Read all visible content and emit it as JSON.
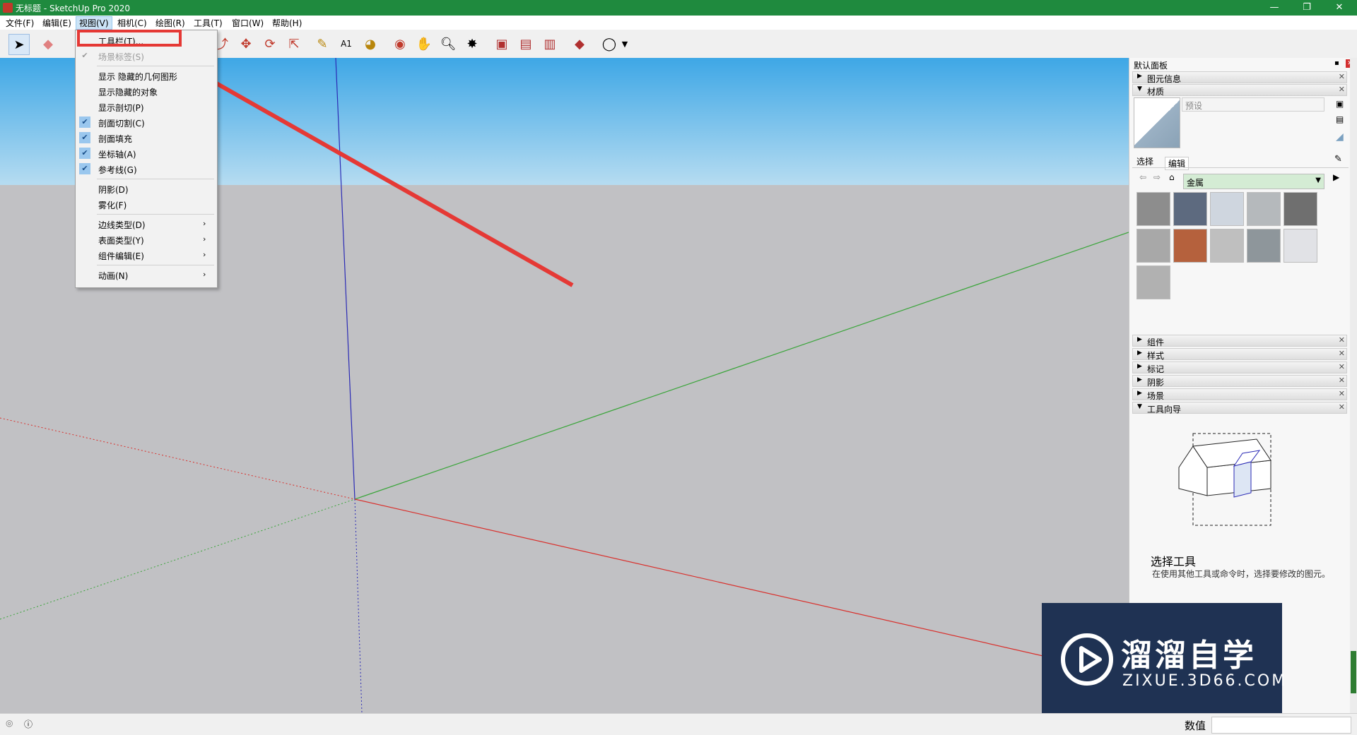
{
  "window": {
    "title": "无标题 - SketchUp Pro 2020",
    "minimize": "—",
    "restore": "❐",
    "close": "✕"
  },
  "menubar": {
    "items": [
      "文件(F)",
      "编辑(E)",
      "视图(V)",
      "相机(C)",
      "绘图(R)",
      "工具(T)",
      "窗口(W)",
      "帮助(H)"
    ]
  },
  "view_menu": {
    "items": [
      {
        "label": "工具栏(T)...",
        "checked": false,
        "disabled": false,
        "submenu": false
      },
      {
        "label": "场景标签(S)",
        "checked": true,
        "disabled": true,
        "submenu": false
      },
      {
        "label": "显示 隐藏的几何图形",
        "checked": false,
        "disabled": false,
        "submenu": false
      },
      {
        "label": "显示隐藏的对象",
        "checked": false,
        "disabled": false,
        "submenu": false
      },
      {
        "label": "显示剖切(P)",
        "checked": false,
        "disabled": false,
        "submenu": false
      },
      {
        "label": "剖面切割(C)",
        "checked": true,
        "disabled": false,
        "submenu": false
      },
      {
        "label": "剖面填充",
        "checked": true,
        "disabled": false,
        "submenu": false
      },
      {
        "label": "坐标轴(A)",
        "checked": true,
        "disabled": false,
        "submenu": false
      },
      {
        "label": "参考线(G)",
        "checked": true,
        "disabled": false,
        "submenu": false
      },
      {
        "label": "阴影(D)",
        "checked": false,
        "disabled": false,
        "submenu": false
      },
      {
        "label": "雾化(F)",
        "checked": false,
        "disabled": false,
        "submenu": false
      },
      {
        "label": "边线类型(D)",
        "checked": false,
        "disabled": false,
        "submenu": true
      },
      {
        "label": "表面类型(Y)",
        "checked": false,
        "disabled": false,
        "submenu": true
      },
      {
        "label": "组件编辑(E)",
        "checked": false,
        "disabled": false,
        "submenu": true
      },
      {
        "label": "动画(N)",
        "checked": false,
        "disabled": false,
        "submenu": true
      }
    ],
    "check_glyph": "✔",
    "arrow_glyph": "›"
  },
  "panel": {
    "title": "默认面板",
    "entity_info": "图元信息",
    "materials": "材质",
    "material_name": "预设",
    "tab_select": "选择",
    "tab_edit": "编辑",
    "library": "金属",
    "swatch_colors": [
      "#8d8d8d",
      "#5d6a7f",
      "#cfd6df",
      "#b5b9bc",
      "#6f6f6f",
      "#a8a8a8",
      "#b5613d",
      "#bfbfbf",
      "#8e969b",
      "#e1e2e6",
      "#b1b1b1"
    ],
    "sections": [
      "组件",
      "样式",
      "标记",
      "阴影",
      "场景"
    ],
    "instructor": "工具向导",
    "tool_title": "选择工具",
    "tool_desc": "在使用其他工具或命令时，选择要修改的图元。"
  },
  "status": {
    "measure_label": "数值"
  },
  "watermark": {
    "brand": "溜溜自学",
    "url": "ZIXUE.3D66.COM"
  },
  "colors": {
    "title_bar": "#1f8a3e",
    "highlight": "#e53935",
    "axis_red": "#d9302c",
    "axis_green": "#3aa53a",
    "axis_blue": "#2b2bb5"
  }
}
